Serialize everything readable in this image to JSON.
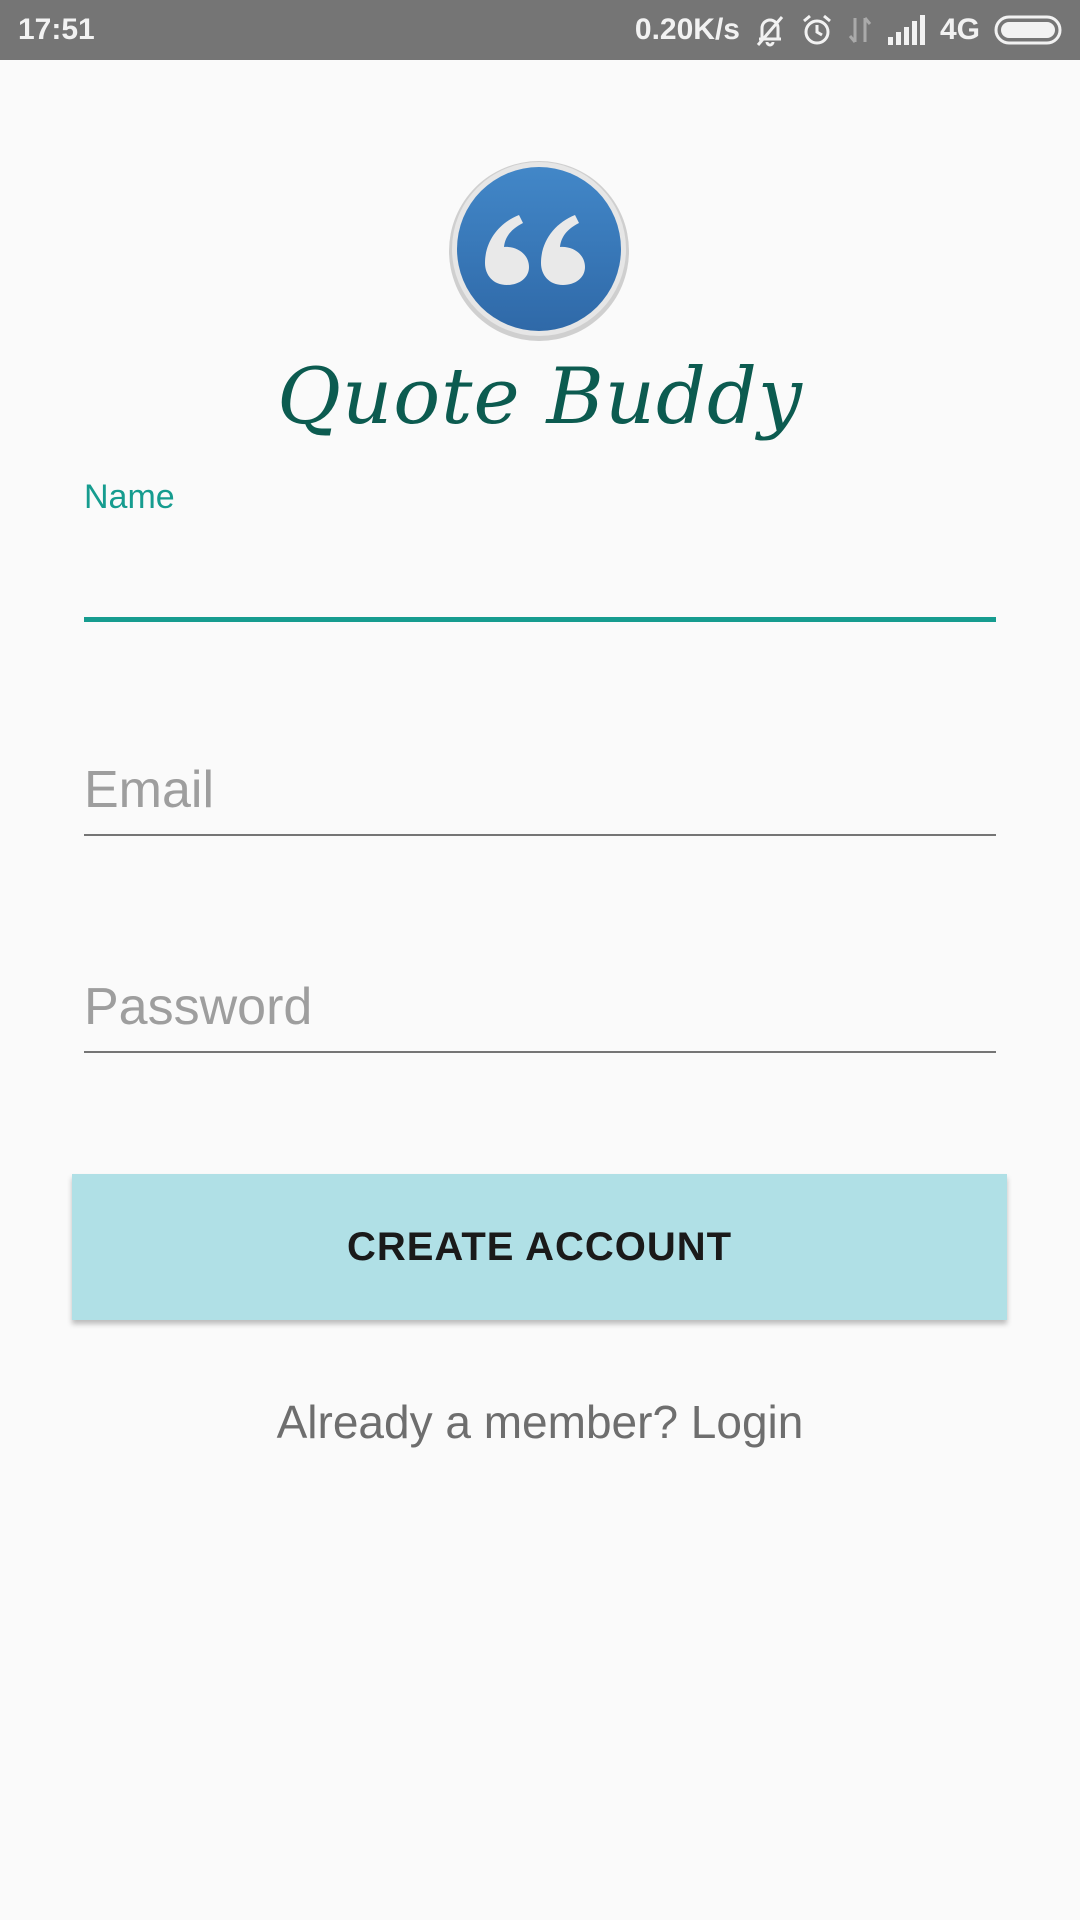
{
  "status_bar": {
    "time": "17:51",
    "net_speed": "0.20K/s",
    "network_type": "4G",
    "icons": [
      "bell-off-icon",
      "alarm-icon",
      "data-arrows-icon",
      "signal-icon",
      "battery-icon"
    ]
  },
  "app": {
    "logo_icon": "quote-mark-icon",
    "title": "Quote Buddy",
    "brand_color": "#0c5b50",
    "accent_color": "#169c8f"
  },
  "form": {
    "name_label": "Name",
    "name_value": "",
    "email_placeholder": "Email",
    "email_value": "",
    "password_placeholder": "Password",
    "password_value": ""
  },
  "create_button_label": "CREATE ACCOUNT",
  "login_link_text": "Already a member? Login"
}
